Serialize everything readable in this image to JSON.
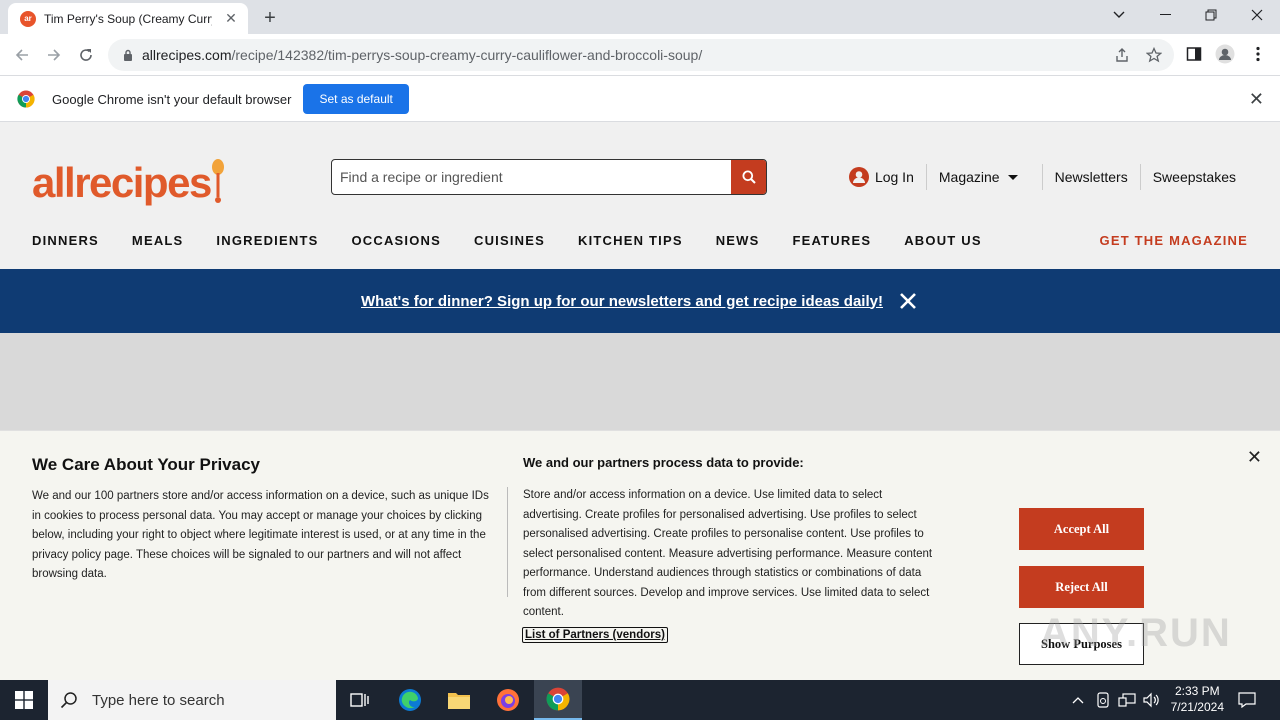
{
  "browser": {
    "tab_title": "Tim Perry's Soup (Creamy Curry",
    "tab_favicon": "ar",
    "url_host": "allrecipes.com",
    "url_path": "/recipe/142382/tim-perrys-soup-creamy-curry-cauliflower-and-broccoli-soup/",
    "infobar_text": "Google Chrome isn't your default browser",
    "set_default_label": "Set as default"
  },
  "site": {
    "logo": "allrecipes",
    "search_placeholder": "Find a recipe or ingredient",
    "login": "Log In",
    "magazine": "Magazine",
    "newsletters": "Newsletters",
    "sweepstakes": "Sweepstakes",
    "nav": [
      "DINNERS",
      "MEALS",
      "INGREDIENTS",
      "OCCASIONS",
      "CUISINES",
      "KITCHEN TIPS",
      "NEWS",
      "FEATURES",
      "ABOUT US"
    ],
    "get_magazine": "GET THE MAGAZINE",
    "banner_text": "What's for dinner? Sign up for our newsletters and get recipe ideas daily!",
    "brand_color": "#e05a2b",
    "banner_color": "#0f3b73"
  },
  "privacy": {
    "title": "We Care About Your Privacy",
    "body": "We and our 100 partners store and/or access information on a device, such as unique IDs in cookies to process personal data. You may accept or manage your choices by clicking below, including your right to object where legitimate interest is used, or at any time in the privacy policy page. These choices will be signaled to our partners and will not affect browsing data.",
    "purposes_title": "We and our partners process data to provide:",
    "purposes_body": "Store and/or access information on a device. Use limited data to select advertising. Create profiles for personalised advertising. Use profiles to select personalised advertising. Create profiles to personalise content. Use profiles to select personalised content. Measure advertising performance. Measure content performance. Understand audiences through statistics or combinations of data from different sources. Develop and improve services. Use limited data to select content.",
    "partners_link": "List of Partners (vendors)",
    "accept": "Accept All",
    "reject": "Reject All",
    "show_purposes": "Show Purposes",
    "watermark": "ANY.RUN"
  },
  "taskbar": {
    "search_placeholder": "Type here to search",
    "time": "2:33 PM",
    "date": "7/21/2024"
  }
}
